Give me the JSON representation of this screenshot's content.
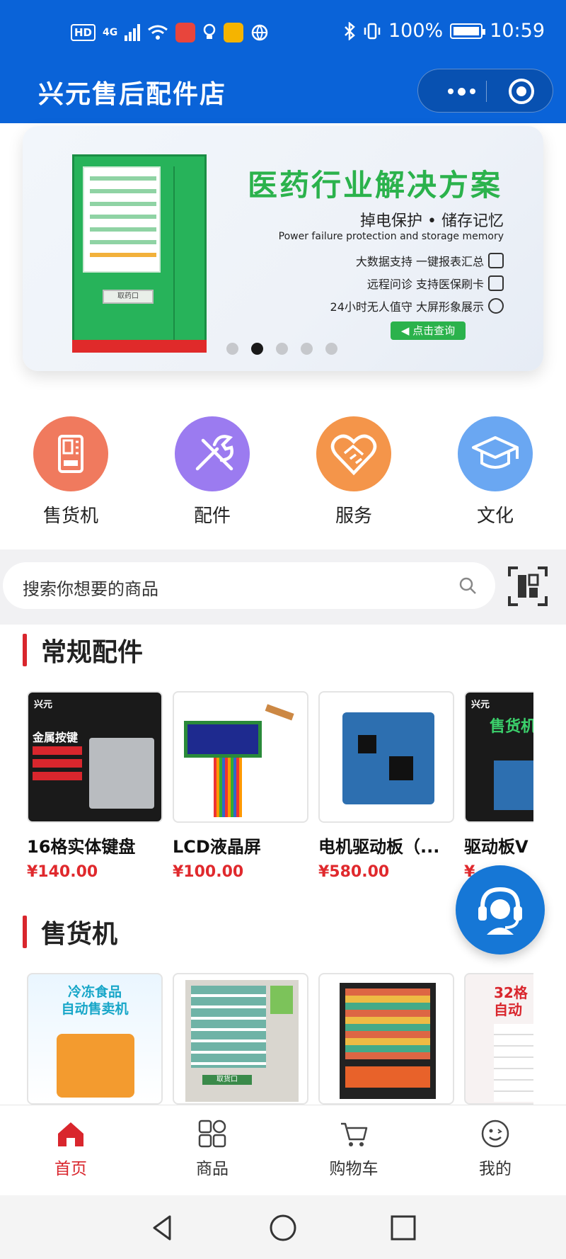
{
  "status_bar": {
    "network": "HD",
    "signal": "4G",
    "battery": "100%",
    "time": "10:59"
  },
  "header": {
    "title": "兴元售后配件店",
    "more_icon": "more-dots-icon",
    "close_icon": "target-circle-icon"
  },
  "banner": {
    "title": "医药行业解决方案",
    "subtitle": "掉电保护 • 储存记忆",
    "subtitle_en": "Power failure protection and storage memory",
    "features": [
      "大数据支持 一键报表汇总",
      "远程问诊 支持医保刷卡",
      "24小时无人值守 大屏形象展示"
    ],
    "cta": "点击查询",
    "machine_slot": "取药口",
    "dots": 5,
    "active_dot": 2
  },
  "categories": [
    {
      "label": "售货机",
      "icon": "vending-machine-icon",
      "color": "#f07a5e"
    },
    {
      "label": "配件",
      "icon": "tools-icon",
      "color": "#9b7bf0"
    },
    {
      "label": "服务",
      "icon": "handshake-heart-icon",
      "color": "#f4954a"
    },
    {
      "label": "文化",
      "icon": "graduation-cap-icon",
      "color": "#6aa7f2"
    }
  ],
  "search": {
    "placeholder": "搜索你想要的商品"
  },
  "sections": {
    "parts": {
      "title": "常规配件",
      "products": [
        {
          "name": "16格实体键盘",
          "price": "¥140.00",
          "image_tags": [
            "兴元",
            "金属按键"
          ]
        },
        {
          "name": "LCD液晶屏",
          "price": "¥100.00"
        },
        {
          "name": "电机驱动板（...",
          "price": "¥580.00"
        },
        {
          "name": "驱动板V",
          "price": "¥",
          "image_tags": [
            "兴元",
            "售货机"
          ]
        }
      ]
    },
    "vending": {
      "title": "售货机",
      "products": [
        {
          "image_tags": [
            "冷冻食品",
            "自动售卖机"
          ]
        },
        {
          "image_tags": [
            "取货口"
          ]
        },
        {},
        {
          "image_tags": [
            "32格",
            "自动"
          ]
        }
      ]
    }
  },
  "tabs": [
    {
      "label": "首页",
      "icon": "home-icon",
      "active": true
    },
    {
      "label": "商品",
      "icon": "grid-icon",
      "active": false
    },
    {
      "label": "购物车",
      "icon": "cart-icon",
      "active": false
    },
    {
      "label": "我的",
      "icon": "smiley-icon",
      "active": false
    }
  ],
  "colors": {
    "brand_blue": "#0a63d8",
    "accent_red": "#d9262d",
    "price_red": "#e0292d",
    "banner_green": "#2bb24c"
  }
}
